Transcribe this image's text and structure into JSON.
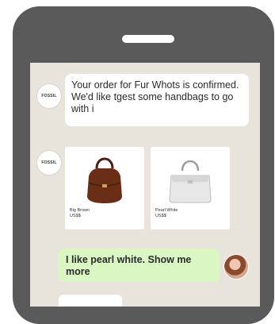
{
  "brand_avatar_text": "FOSSIL",
  "chat": {
    "bot_message": "Your order for Fur Whots is confirmed. We'd like tgest some handbags to go with i",
    "products": [
      {
        "name": "Big Brown",
        "price": "US$$",
        "color": "#6a2d16"
      },
      {
        "name": "Pearl White",
        "price": "US$$",
        "color": "#e7e7e7"
      }
    ],
    "user_message": "I like pearl white. Show me more"
  },
  "colors": {
    "phone_frame": "#5a5a5a",
    "chat_background": "#e8e3db",
    "user_bubble": "#d9f6c3"
  }
}
